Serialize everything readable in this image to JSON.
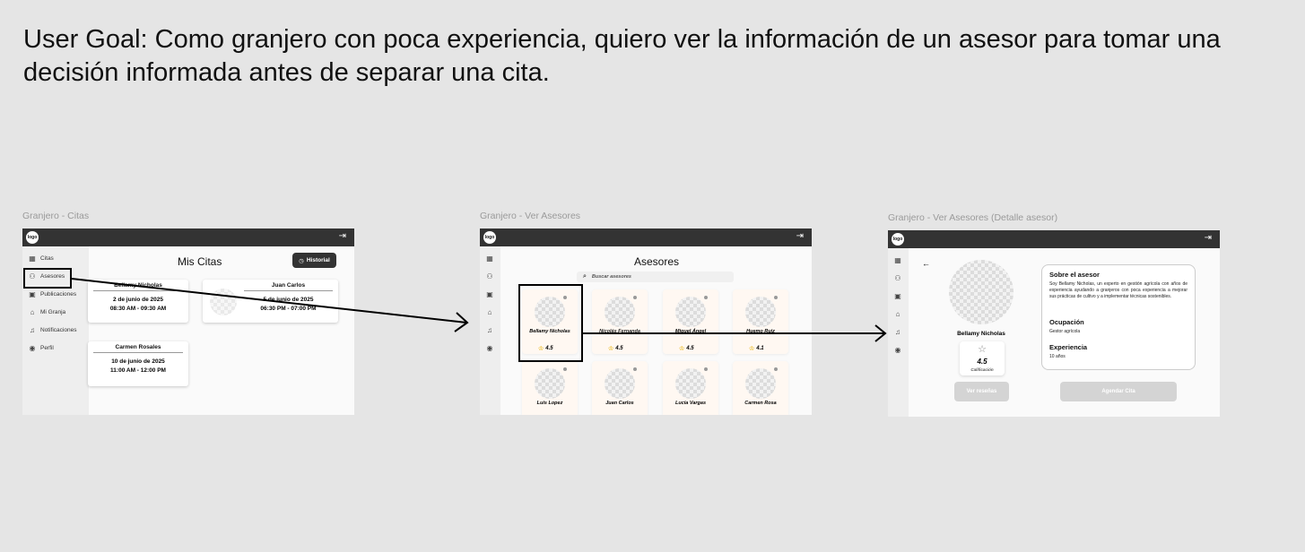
{
  "goal": "User Goal: Como granjero con poca experiencia, quiero ver la información de un asesor para tomar una decisión informada antes de separar una cita.",
  "common": {
    "logo": "logo",
    "logout_icon": "logout-icon",
    "sidebar": [
      "Citas",
      "Asesores",
      "Publicaciones",
      "Mi Granja",
      "Notificaciones",
      "Perfil"
    ]
  },
  "frame1": {
    "title": "Granjero - Citas",
    "page_title": "Mis Citas",
    "historial": "Historial",
    "cards": [
      {
        "name": "Bellamy Nicholas",
        "date": "2 de junio de 2025",
        "time": "08:30 AM - 09:30 AM"
      },
      {
        "name": "Juan Carlos",
        "date": "5 de junio de 2025",
        "time": "06:30 PM - 07:00 PM"
      },
      {
        "name": "Carmen Rosales",
        "date": "10 de junio de 2025",
        "time": "11:00 AM - 12:00 PM"
      }
    ]
  },
  "frame2": {
    "title": "Granjero - Ver Asesores",
    "page_title": "Asesores",
    "search_placeholder": "Buscar asesores",
    "advisors": [
      {
        "name": "Bellamy Nicholas",
        "rating": "4.5"
      },
      {
        "name": "Nicolás Fernanda",
        "rating": "4.5"
      },
      {
        "name": "Miguel Ángel",
        "rating": "4.5"
      },
      {
        "name": "Huemo Ruiz",
        "rating": "4.1"
      },
      {
        "name": "Luis Lopez",
        "rating": ""
      },
      {
        "name": "Juan Carlos",
        "rating": ""
      },
      {
        "name": "Lucía Vargas",
        "rating": ""
      },
      {
        "name": "Carmen Rosa",
        "rating": ""
      }
    ]
  },
  "frame3": {
    "title": "Granjero - Ver Asesores (Detalle asesor)",
    "back": "←",
    "name": "Bellamy Nicholas",
    "rating": "4.5",
    "rating_label": "Calificación",
    "about_title": "Sobre el asesor",
    "about_text": "Soy Bellamy Nicholas, un experto en gestión agrícola con años de experiencia ayudando a granjeros con poca experiencia a mejorar sus prácticas de cultivo y a implementar técnicas sostenibles.",
    "occupation_title": "Ocupación",
    "occupation": "Gestor agrícola",
    "experience_title": "Experiencia",
    "experience": "10 años",
    "reviews_button": "Ver reseñas",
    "schedule_button": "Agendar Cita"
  }
}
